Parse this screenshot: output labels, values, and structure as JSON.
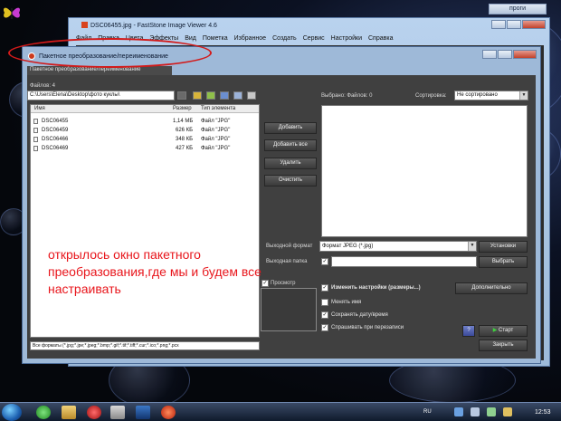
{
  "desktop": {
    "progi_label": "проги"
  },
  "viewer": {
    "title": "DSC06455.jpg - FastStone Image Viewer 4.6",
    "menu": [
      "Файл",
      "Правка",
      "Цвета",
      "Эффекты",
      "Вид",
      "Пометка",
      "Избранное",
      "Создать",
      "Сервис",
      "Настройки",
      "Справка"
    ]
  },
  "dialog": {
    "title": "Пакетное преобразование/переименование",
    "tab_label": "Пакетное преобразование/переименование",
    "files_count_label": "Файлов: 4",
    "path_value": "C:\\Users\\Elena\\Desktop\\фото куклы\\",
    "columns": {
      "name": "Имя",
      "size": "Размер",
      "type": "Тип элемента"
    },
    "files": [
      {
        "name": "DSC06455",
        "size": "1,14 МБ",
        "type": "Файл \"JPG\""
      },
      {
        "name": "DSC06459",
        "size": "626 КБ",
        "type": "Файл \"JPG\""
      },
      {
        "name": "DSC06466",
        "size": "348 КБ",
        "type": "Файл \"JPG\""
      },
      {
        "name": "DSC06469",
        "size": "427 КБ",
        "type": "Файл \"JPG\""
      }
    ],
    "formats_filter": "Все форматы (*.jpg;*.jpe;*.jpeg;*.bmp;*.gif;*.tif;*.tiff;*.cur;*.ico;*.png;*.pcx",
    "buttons": {
      "add": "Добавить",
      "add_all": "Добавить все",
      "remove": "Удалить",
      "clear": "Очистить",
      "settings": "Установки",
      "browse": "Выбрать",
      "advanced": "Дополнительно",
      "start": "Старт",
      "close": "Закрыть"
    },
    "selected_label": "Выбрано: Файлов: 0",
    "sort_label": "Сортировка:",
    "sort_value": "Не сортировано",
    "output_format_label": "Выходной формат",
    "output_format_value": "Формат JPEG (*.jpg)",
    "output_folder_label": "Выходная папка",
    "preview_label": "Просмотр",
    "options": {
      "change_settings": "Изменить настройки (размеры...)",
      "rename": "Менять имя",
      "keep_date": "Сохранять дату/время",
      "ask_overwrite": "Спрашивать при перезаписи"
    }
  },
  "annotation": "открылось окно пакетного преобразования,где мы и будем все настраивать",
  "taskbar": {
    "lang": "RU",
    "time": "12:53"
  }
}
